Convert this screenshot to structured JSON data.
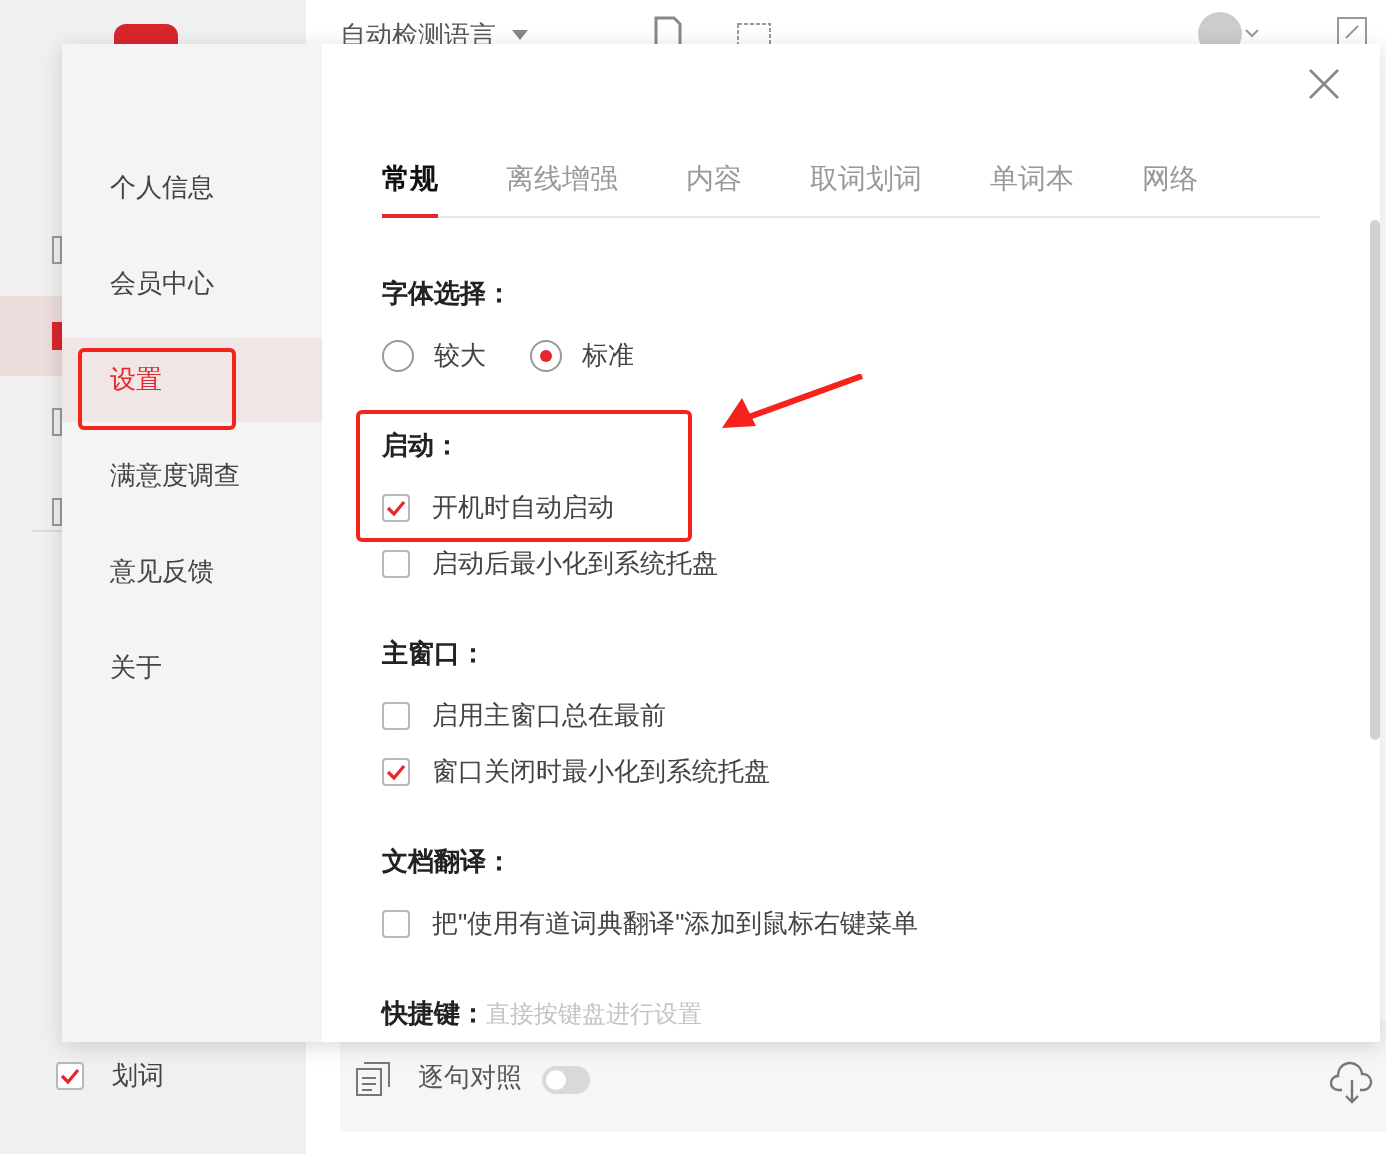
{
  "app": {
    "language_selector": "自动检测语言",
    "sidebar_option": {
      "label": "划词",
      "checked": true
    },
    "bottom_bar": {
      "compare_label": "逐句对照",
      "compare_on": false
    }
  },
  "dialog": {
    "nav": [
      {
        "label": "个人信息",
        "selected": false
      },
      {
        "label": "会员中心",
        "selected": false
      },
      {
        "label": "设置",
        "selected": true
      },
      {
        "label": "满意度调查",
        "selected": false
      },
      {
        "label": "意见反馈",
        "selected": false
      },
      {
        "label": "关于",
        "selected": false
      }
    ],
    "tabs": [
      {
        "label": "常规",
        "selected": true
      },
      {
        "label": "离线增强",
        "selected": false
      },
      {
        "label": "内容",
        "selected": false
      },
      {
        "label": "取词划词",
        "selected": false
      },
      {
        "label": "单词本",
        "selected": false
      },
      {
        "label": "网络",
        "selected": false
      }
    ],
    "sections": [
      {
        "title": "字体选择：",
        "kind": "radio",
        "options": [
          {
            "label": "较大",
            "selected": false
          },
          {
            "label": "标准",
            "selected": true
          }
        ]
      },
      {
        "title": "启动：",
        "kind": "checkbox",
        "options": [
          {
            "label": "开机时自动启动",
            "checked": true
          },
          {
            "label": "启动后最小化到系统托盘",
            "checked": false
          }
        ]
      },
      {
        "title": "主窗口：",
        "kind": "checkbox",
        "options": [
          {
            "label": "启用主窗口总在最前",
            "checked": false
          },
          {
            "label": "窗口关闭时最小化到系统托盘",
            "checked": true
          }
        ]
      },
      {
        "title": "文档翻译：",
        "kind": "checkbox",
        "options": [
          {
            "label": "把\"使用有道词典翻译\"添加到鼠标右键菜单",
            "checked": false
          }
        ]
      },
      {
        "title": "快捷键：",
        "kind": "hint",
        "hint": "直接按键盘进行设置"
      }
    ]
  }
}
